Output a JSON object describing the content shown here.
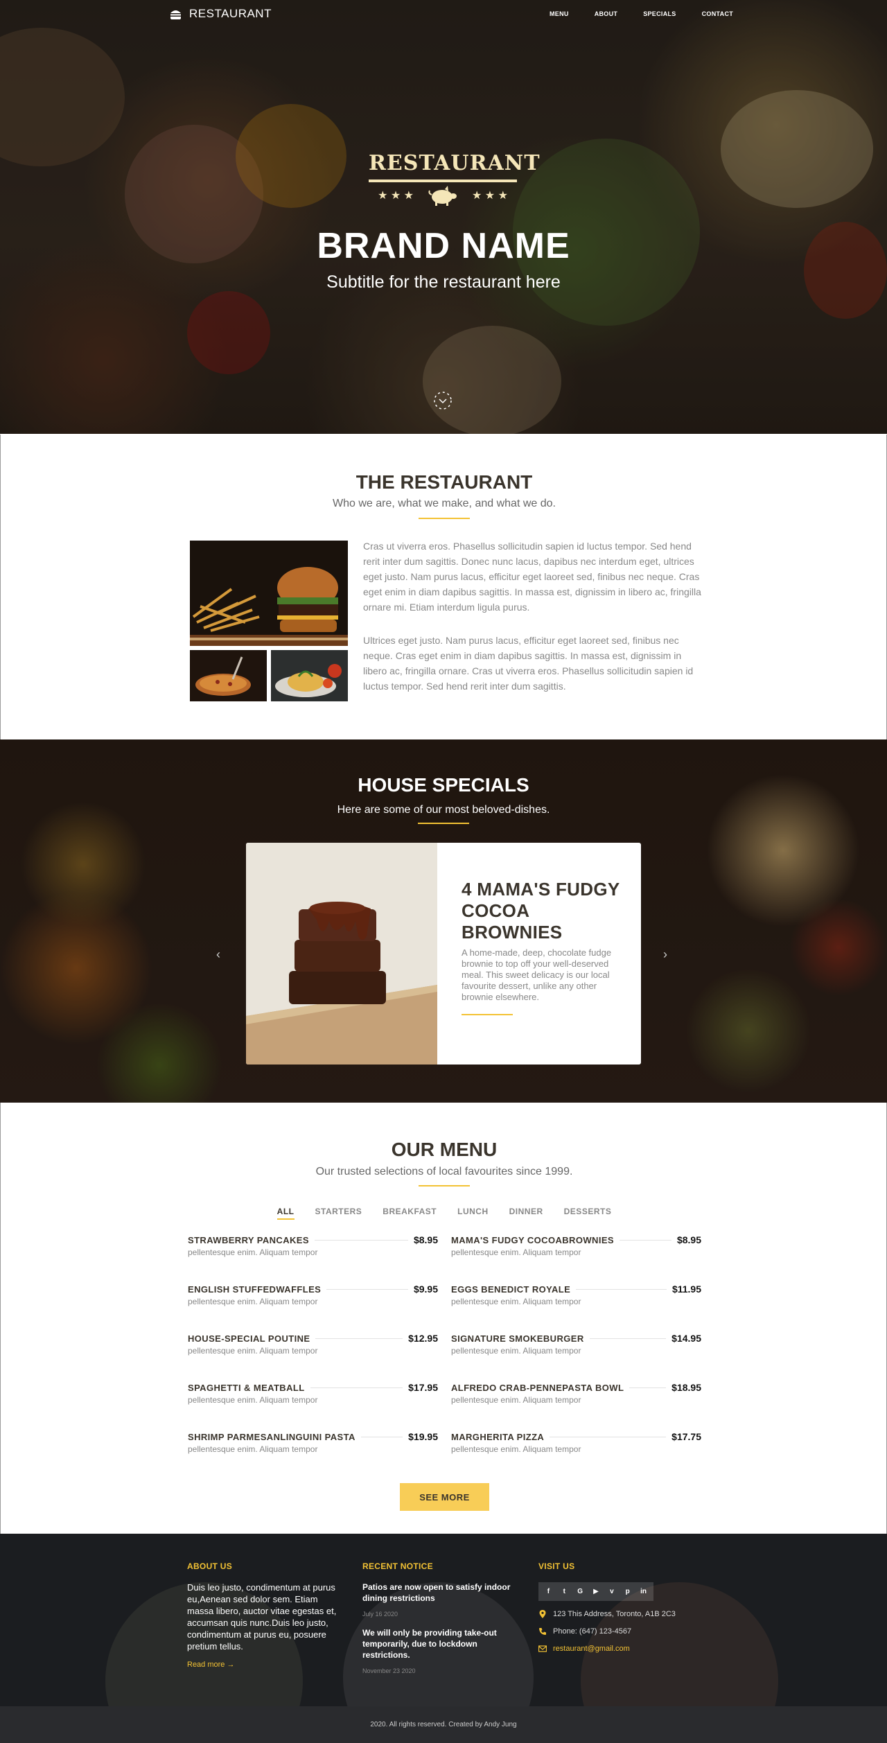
{
  "nav": {
    "brand": "RESTAURANT",
    "items": [
      "MENU",
      "ABOUT",
      "SPECIALS",
      "CONTACT"
    ]
  },
  "hero": {
    "logo_word": "RESTAURANT",
    "stars_left": "★ ★ ★",
    "stars_right": "★ ★ ★",
    "title": "BRAND NAME",
    "subtitle": "Subtitle for the restaurant here"
  },
  "about": {
    "title": "THE RESTAURANT",
    "subtitle": "Who we are, what we make, and what we do.",
    "paragraphs": [
      "Cras ut viverra eros. Phasellus sollicitudin sapien id luctus tempor. Sed hend rerit inter dum sagittis. Donec nunc lacus, dapibus nec interdum eget, ultrices eget justo. Nam purus lacus, efficitur eget laoreet sed, finibus nec neque. Cras eget enim in diam dapibus sagittis. In massa est, dignissim in libero ac, fringilla ornare mi. Etiam interdum ligula purus.",
      "Ultrices eget justo. Nam purus lacus, efficitur eget laoreet sed, finibus nec neque. Cras eget enim in diam dapibus sagittis. In massa est, dignissim in libero ac, fringilla ornare. Cras ut viverra eros. Phasellus sollicitudin sapien id luctus tempor. Sed hend rerit inter dum sagittis."
    ]
  },
  "specials": {
    "title": "HOUSE SPECIALS",
    "subtitle": "Here are some of our most beloved-dishes.",
    "card_title": "4 MAMA'S FUDGY COCOA BROWNIES",
    "card_desc": "A home-made, deep, chocolate fudge brownie to top off your well-deserved meal. This sweet delicacy is our local favourite dessert, unlike any other brownie elsewhere.",
    "prev": "‹",
    "next": "›"
  },
  "menu": {
    "title": "OUR MENU",
    "subtitle": "Our trusted selections of local favourites since 1999.",
    "filters": [
      "ALL",
      "STARTERS",
      "BREAKFAST",
      "LUNCH",
      "DINNER",
      "DESSERTS"
    ],
    "items": [
      {
        "name": "STRAWBERRY PANCAKES",
        "price": "$8.95",
        "desc": "pellentesque enim. Aliquam tempor"
      },
      {
        "name": "MAMA'S FUDGY COCOABROWNIES",
        "price": "$8.95",
        "desc": "pellentesque enim. Aliquam tempor"
      },
      {
        "name": "ENGLISH STUFFEDWAFFLES",
        "price": "$9.95",
        "desc": "pellentesque enim. Aliquam tempor"
      },
      {
        "name": "EGGS BENEDICT ROYALE",
        "price": "$11.95",
        "desc": "pellentesque enim. Aliquam tempor"
      },
      {
        "name": "HOUSE-SPECIAL POUTINE",
        "price": "$12.95",
        "desc": "pellentesque enim. Aliquam tempor"
      },
      {
        "name": "SIGNATURE SMOKEBURGER",
        "price": "$14.95",
        "desc": "pellentesque enim. Aliquam tempor"
      },
      {
        "name": "SPAGHETTI & MEATBALL",
        "price": "$17.95",
        "desc": "pellentesque enim. Aliquam tempor"
      },
      {
        "name": "ALFREDO CRAB-PENNEPASTA BOWL",
        "price": "$18.95",
        "desc": "pellentesque enim. Aliquam tempor"
      },
      {
        "name": "SHRIMP PARMESANLINGUINI PASTA",
        "price": "$19.95",
        "desc": "pellentesque enim. Aliquam tempor"
      },
      {
        "name": "MARGHERITA PIZZA",
        "price": "$17.75",
        "desc": "pellentesque enim. Aliquam tempor"
      }
    ],
    "see_more": "SEE MORE"
  },
  "footer": {
    "about_title": "ABOUT US",
    "about_text": "Duis leo justo, condimentum at purus eu,Aenean sed dolor sem. Etiam massa libero, auctor vitae egestas et, accumsan quis nunc.Duis leo justo, condimentum at purus eu, posuere pretium tellus.",
    "read_more": "Read more →",
    "notice_title": "RECENT NOTICE",
    "notices": [
      {
        "title": "Patios are now open to satisfy indoor dining restrictions",
        "date": "July 16 2020"
      },
      {
        "title": "We will only be providing take-out temporarily, due to lockdown restrictions.",
        "date": "November 23 2020"
      }
    ],
    "visit_title": "VISIT US",
    "socials": [
      "facebook-icon",
      "twitter-icon",
      "google-icon",
      "youtube-icon",
      "vimeo-icon",
      "pinterest-icon",
      "linkedin-icon"
    ],
    "address": "123 This Address, Toronto, A1B 2C3",
    "phone": "Phone: (647) 123-4567",
    "email": "restaurant@gmail.com",
    "copyright": "2020. All rights reserved. Created by Andy Jung"
  },
  "colors": {
    "accent": "#f3c234",
    "button": "#f8cd57",
    "heading": "#3a342c",
    "footer_bg": "#1b1d20"
  }
}
